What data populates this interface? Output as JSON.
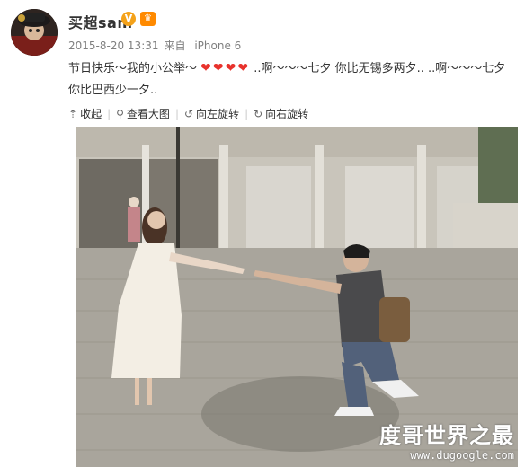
{
  "post": {
    "username": "买超sam",
    "verified_icon": "verified-v-icon",
    "level_icon": "vip-level-icon",
    "timestamp": "2015-8-20 13:31",
    "source_prefix": "来自",
    "device": "iPhone 6",
    "text_before_hearts": "节日快乐～我的小公举～",
    "hearts": "❤❤❤❤",
    "text_after_hearts": "..啊～～～七夕   你比无锡多两夕..  ..啊～～～七夕   你比巴西少一夕..",
    "heart_color": "#e8322c"
  },
  "toolbar": {
    "collapse": "收起",
    "view_large": "查看大图",
    "rotate_left": "向左旋转",
    "rotate_right": "向右旋转"
  },
  "watermark": {
    "site_name": "度哥世界之最",
    "site_url": "www.dugoogle.com"
  }
}
